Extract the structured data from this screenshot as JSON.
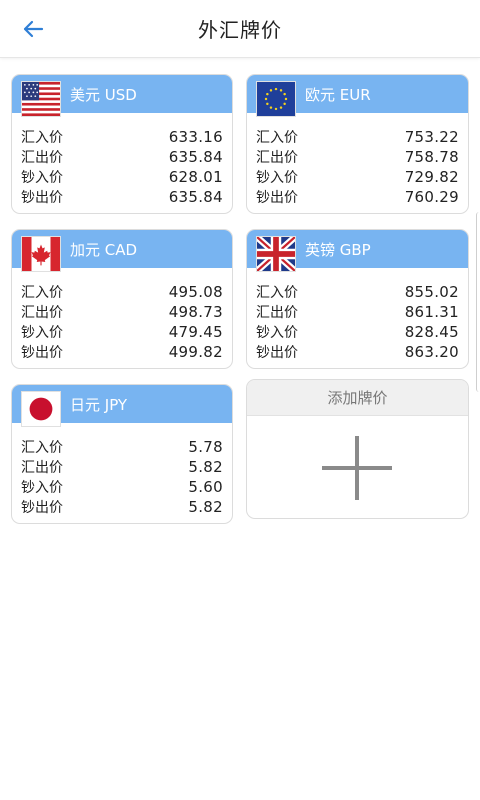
{
  "header": {
    "title": "外汇牌价",
    "back_icon": "back-arrow-icon",
    "accent": "#2f7fd6"
  },
  "theme": {
    "card_header": "#78b4f1"
  },
  "row_labels": {
    "buy_remit": "汇入价",
    "sell_remit": "汇出价",
    "buy_cash": "钞入价",
    "sell_cash": "钞出价"
  },
  "currencies": [
    {
      "name": "美元 USD",
      "flag": "us-flag-icon",
      "rates": [
        "633.16",
        "635.84",
        "628.01",
        "635.84"
      ]
    },
    {
      "name": "欧元 EUR",
      "flag": "eu-flag-icon",
      "rates": [
        "753.22",
        "758.78",
        "729.82",
        "760.29"
      ]
    },
    {
      "name": "加元 CAD",
      "flag": "canada-flag-icon",
      "rates": [
        "495.08",
        "498.73",
        "479.45",
        "499.82"
      ]
    },
    {
      "name": "英镑 GBP",
      "flag": "uk-flag-icon",
      "rates": [
        "855.02",
        "861.31",
        "828.45",
        "863.20"
      ]
    },
    {
      "name": "日元 JPY",
      "flag": "japan-flag-icon",
      "rates": [
        "5.78",
        "5.82",
        "5.60",
        "5.82"
      ]
    }
  ],
  "add_card": {
    "label": "添加牌价",
    "icon": "plus-icon"
  }
}
